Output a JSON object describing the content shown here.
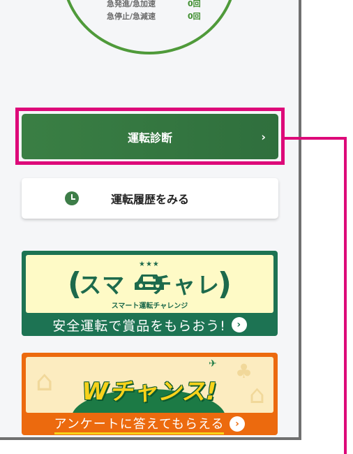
{
  "stats": {
    "rows": [
      {
        "label": "急発進/急加速",
        "value": "0回"
      },
      {
        "label": "急停止/急減速",
        "value": "0回"
      }
    ]
  },
  "diagnosis_button": {
    "label": "運転診断",
    "chevron": "›"
  },
  "history_button": {
    "label": "運転履歴をみる",
    "icon": "clock-icon"
  },
  "banner_smart": {
    "title": "スマ　チャレ",
    "subtitle": "スマート運転チャレンジ",
    "cta": "安全運転で賞品をもらおう!",
    "arrow": "›"
  },
  "banner_wchance": {
    "title": "Wチャンス!",
    "cta": "アンケートに答えてもらえる",
    "arrow": "›"
  },
  "colors": {
    "primary_green": "#2f6f3d",
    "highlight_magenta": "#dd0a79",
    "orange": "#ec6a0e",
    "banner_green": "#1d7353"
  }
}
